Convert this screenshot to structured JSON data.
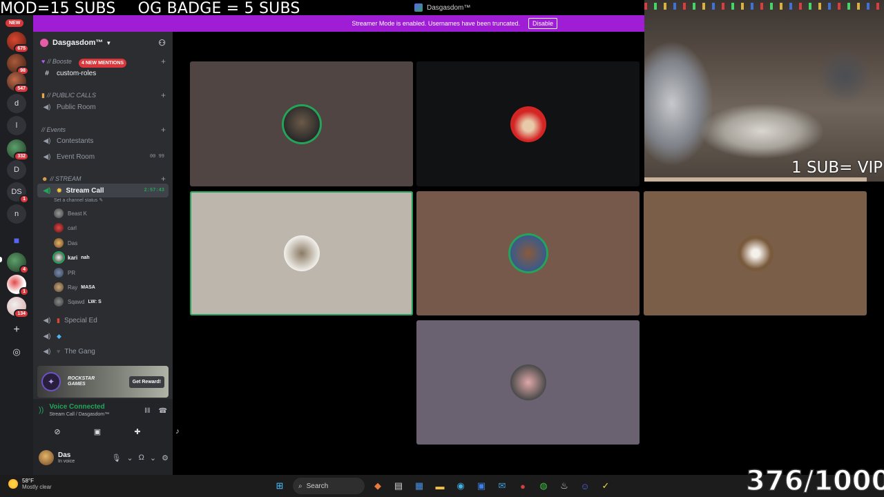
{
  "overlay": {
    "mod_text": "MOD=15 SUBS",
    "og_text": "OG BADGE = 5 SUBS",
    "vip_text": "1 SUB= VIP",
    "counter": "376/1000"
  },
  "window": {
    "title": "Dasgasdom™"
  },
  "banner": {
    "message": "Streamer Mode is enabled. Usernames have been truncated.",
    "button": "Disable"
  },
  "rail": {
    "new_badge": "NEW",
    "items": [
      {
        "letter": "",
        "count": "675"
      },
      {
        "letter": "",
        "count": "98"
      },
      {
        "letter": "",
        "count": "547"
      },
      {
        "letter": "d"
      },
      {
        "letter": "l"
      },
      {
        "letter": "",
        "count": "332"
      },
      {
        "letter": "D"
      },
      {
        "letter": "DS",
        "count": "1"
      },
      {
        "letter": "n"
      },
      {
        "letter": "",
        "count": "4"
      },
      {
        "letter": "",
        "count": "1"
      },
      {
        "letter": "",
        "count": "134"
      }
    ]
  },
  "server": {
    "name": "Dasgasdom™",
    "mentions": "4 NEW MENTIONS",
    "categories": {
      "boosters": "// Booste",
      "public_calls": "// PUBLIC CALLS",
      "events": "// Events",
      "stream": "// STREAM"
    },
    "channels": {
      "custom_roles": "custom-roles",
      "public_room": "Public Room",
      "contestants": "Contestants",
      "event_room": "Event Room",
      "event_room_counts": "00  99",
      "stream_call": "Stream Call",
      "stream_timer": "2:57:43",
      "stream_status": "Set a channel status",
      "special_ed": "Special Ed",
      "the_gang": "The Gang"
    },
    "members": [
      {
        "name": "Beast K",
        "tag": ""
      },
      {
        "name": "carl",
        "tag": ""
      },
      {
        "name": "Das",
        "tag": ""
      },
      {
        "name": "kari",
        "tag": "nah"
      },
      {
        "name": "PR",
        "tag": ""
      },
      {
        "name": "Ray",
        "tag": "MASA"
      },
      {
        "name": "Sqawd",
        "tag": "LW: S"
      }
    ]
  },
  "promo": {
    "brand": "ROCKSTAR GAMES",
    "button": "Get Reward!"
  },
  "voice": {
    "status": "Voice Connected",
    "location": "Stream Call / Dasgasdom™"
  },
  "user": {
    "name": "Das",
    "status": "In voice"
  },
  "colors": {
    "banner": "#a01dd6",
    "speaking": "#23a559",
    "accent": "#5865f2"
  },
  "taskbar": {
    "temperature": "58°F",
    "condition": "Mostly clear",
    "search_placeholder": "Search"
  }
}
